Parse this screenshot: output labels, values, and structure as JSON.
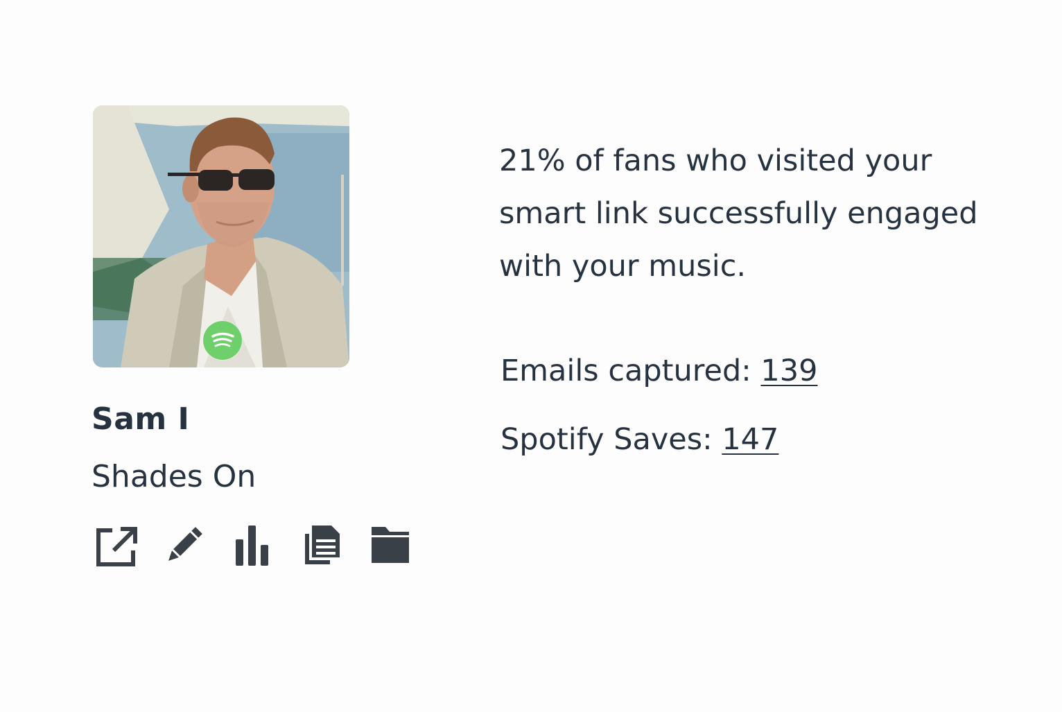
{
  "release": {
    "artist": "Sam I",
    "title": "Shades On",
    "platform_badge": "spotify-icon"
  },
  "actions": [
    {
      "icon": "external-link-icon"
    },
    {
      "icon": "pencil-icon"
    },
    {
      "icon": "bar-chart-icon"
    },
    {
      "icon": "copy-icon"
    },
    {
      "icon": "folder-icon"
    }
  ],
  "summary": {
    "text": "21% of fans who visited your smart link successfully engaged with your music."
  },
  "stats": {
    "emails_label": "Emails captured: ",
    "emails_value": "139",
    "saves_label": "Spotify Saves: ",
    "saves_value": "147"
  },
  "colors": {
    "text": "#273240",
    "icon": "#3a4048",
    "spotify_green": "#6fcf6a",
    "background": "#fdfdfd"
  }
}
